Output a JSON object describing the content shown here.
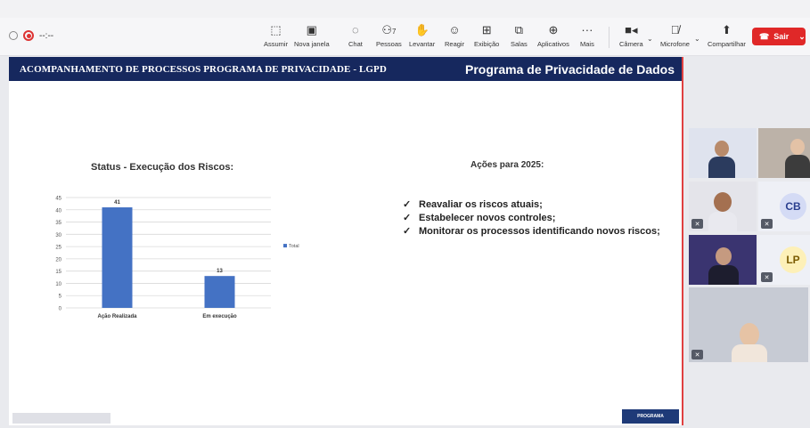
{
  "meeting": {
    "timer": "--:--",
    "colors": {
      "leave": "#e02828",
      "header": "#16285e",
      "bar": "#4472c4"
    }
  },
  "toolbar": {
    "items": [
      {
        "label": "Assumir",
        "icon": "take-control-icon"
      },
      {
        "label": "Nova janela",
        "icon": "new-window-icon"
      },
      {
        "label": "Chat",
        "icon": "chat-icon"
      },
      {
        "label": "Pessoas",
        "icon": "people-icon",
        "count": "7"
      },
      {
        "label": "Levantar",
        "icon": "raise-hand-icon"
      },
      {
        "label": "Reagir",
        "icon": "react-icon"
      },
      {
        "label": "Exibição",
        "icon": "view-icon"
      },
      {
        "label": "Salas",
        "icon": "rooms-icon"
      },
      {
        "label": "Aplicativos",
        "icon": "apps-icon"
      },
      {
        "label": "Mais",
        "icon": "more-icon"
      },
      {
        "label": "Câmera",
        "icon": "camera-icon"
      },
      {
        "label": "Microfone",
        "icon": "mic-muted-icon"
      },
      {
        "label": "Compartilhar",
        "icon": "share-icon"
      }
    ],
    "leave_label": "Sair"
  },
  "slide": {
    "header_left": "ACOMPANHAMENTO DE PROCESSOS PROGRAMA DE PRIVACIDADE - LGPD",
    "header_right": "Programa de Privacidade de Dados",
    "actions_title": "Ações para 2025:",
    "actions": [
      "Reavaliar os riscos atuais;",
      "Estabelecer novos controles;",
      "Monitorar os processos identificando novos riscos;"
    ]
  },
  "chart_data": {
    "type": "bar",
    "title": "Status - Execução dos Riscos:",
    "categories": [
      "Ação Realizada",
      "Em execução"
    ],
    "series": [
      {
        "name": "Total",
        "values": [
          41,
          13
        ]
      }
    ],
    "ylim": [
      0,
      45
    ],
    "yticks": [
      0,
      5,
      10,
      15,
      20,
      25,
      30,
      35,
      40,
      45
    ],
    "grid": true,
    "legend": "right",
    "color": "#4472c4"
  },
  "participants": [
    {
      "type": "video",
      "name": "participant-1"
    },
    {
      "type": "video",
      "name": "participant-2"
    },
    {
      "type": "video-muted",
      "name": "participant-3"
    },
    {
      "type": "initials",
      "initials": "CB",
      "color": "#d4dbf5",
      "text_color": "#2a3f8f"
    },
    {
      "type": "video",
      "name": "participant-5"
    },
    {
      "type": "initials",
      "initials": "LP",
      "color": "#fdf0b8",
      "text_color": "#7a5a00"
    },
    {
      "type": "video-muted",
      "name": "participant-7"
    }
  ]
}
